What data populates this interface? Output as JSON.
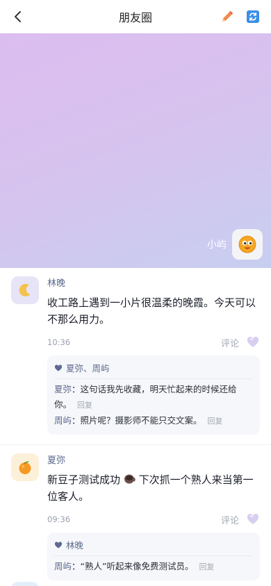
{
  "header": {
    "title": "朋友圈"
  },
  "cover": {
    "user_name": "小屿"
  },
  "posts": [
    {
      "name": "林晚",
      "text": "收工路上遇到一小片很温柔的晚霞。今天可以不那么用力。",
      "time": "10:36",
      "comment_label": "评论",
      "likes": "夏弥、周屿",
      "comments": [
        {
          "name": "夏弥",
          "text": "这句话我先收藏，明天忙起来的时候还给你。",
          "reply": "回复"
        },
        {
          "name": "周屿",
          "text": "照片呢？摄影师不能只交文案。",
          "reply": "回复"
        }
      ]
    },
    {
      "name": "夏弥",
      "text_before": "新豆子测试成功",
      "text_after": " 下次抓一个熟人来当第一位客人。",
      "time": "09:36",
      "comment_label": "评论",
      "likes": "林晚",
      "comments": [
        {
          "name": "周屿",
          "text": "“熟人”听起来像免费测试员。",
          "reply": "回复"
        }
      ]
    }
  ],
  "separator": "："
}
